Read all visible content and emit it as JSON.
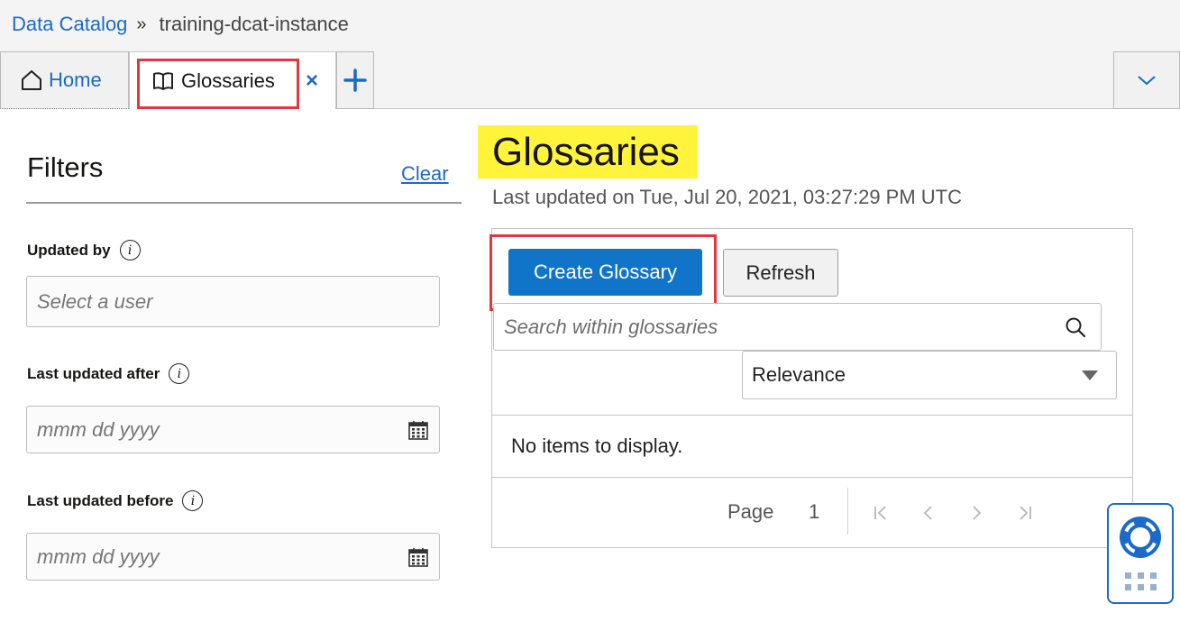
{
  "breadcrumb": {
    "root": "Data Catalog",
    "separator": "»",
    "current": "training-dcat-instance"
  },
  "tabs": {
    "home": "Home",
    "active": "Glossaries",
    "close": "×",
    "add": "+"
  },
  "filters": {
    "title": "Filters",
    "clear": "Clear",
    "updated_by": {
      "label": "Updated by",
      "placeholder": "Select a user"
    },
    "last_updated_after": {
      "label": "Last updated after",
      "placeholder": "mmm dd yyyy"
    },
    "last_updated_before": {
      "label": "Last updated before",
      "placeholder": "mmm dd yyyy"
    },
    "info_glyph": "i"
  },
  "main": {
    "title": "Glossaries",
    "last_updated": "Last updated on Tue, Jul 20, 2021, 03:27:29 PM UTC",
    "create_button": "Create Glossary",
    "refresh_button": "Refresh",
    "search_placeholder": "Search within glossaries",
    "sort_selected": "Relevance",
    "empty_message": "No items to display.",
    "pagination": {
      "label": "Page",
      "current": "1"
    }
  },
  "colors": {
    "accent": "#1074c8",
    "link": "#1b6ac9",
    "annotation_red": "#e0383e",
    "title_highlight": "#fff43a"
  },
  "icons": {
    "home": "home-icon",
    "glossary": "book-icon",
    "search": "search-icon",
    "calendar": "calendar-icon",
    "help": "lifebuoy-icon"
  }
}
